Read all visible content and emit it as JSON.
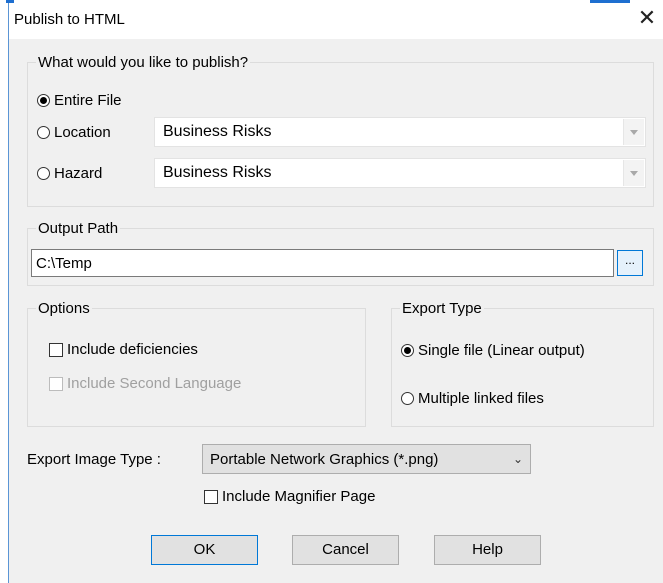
{
  "dialog": {
    "title": "Publish to HTML",
    "close_glyph": "✕"
  },
  "publish_group": {
    "legend": "What would you like to publish?",
    "options": [
      {
        "label": "Entire File",
        "selected": true
      },
      {
        "label": "Location",
        "selected": false,
        "dropdown_value": "Business Risks"
      },
      {
        "label": "Hazard",
        "selected": false,
        "dropdown_value": "Business Risks"
      }
    ]
  },
  "output_group": {
    "legend": "Output Path",
    "path_value": "C:\\Temp",
    "browse_label": "..."
  },
  "options_group": {
    "legend": "Options",
    "include_deficiencies": {
      "label": "Include deficiencies",
      "checked": false
    },
    "include_second_language": {
      "label": "Include Second Language",
      "checked": false,
      "enabled": false
    }
  },
  "export_type_group": {
    "legend": "Export Type",
    "options": [
      {
        "label": "Single file (Linear output)",
        "selected": true
      },
      {
        "label": "Multiple linked files",
        "selected": false
      }
    ]
  },
  "export_image": {
    "label": "Export Image Type :",
    "selected_value": "Portable Network Graphics (*.png)"
  },
  "include_magnifier": {
    "label": "Include Magnifier Page",
    "checked": false
  },
  "buttons": {
    "ok": "OK",
    "cancel": "Cancel",
    "help": "Help"
  },
  "colors": {
    "accent": "#0078d7",
    "dialog_bg": "#f0f0f0"
  }
}
